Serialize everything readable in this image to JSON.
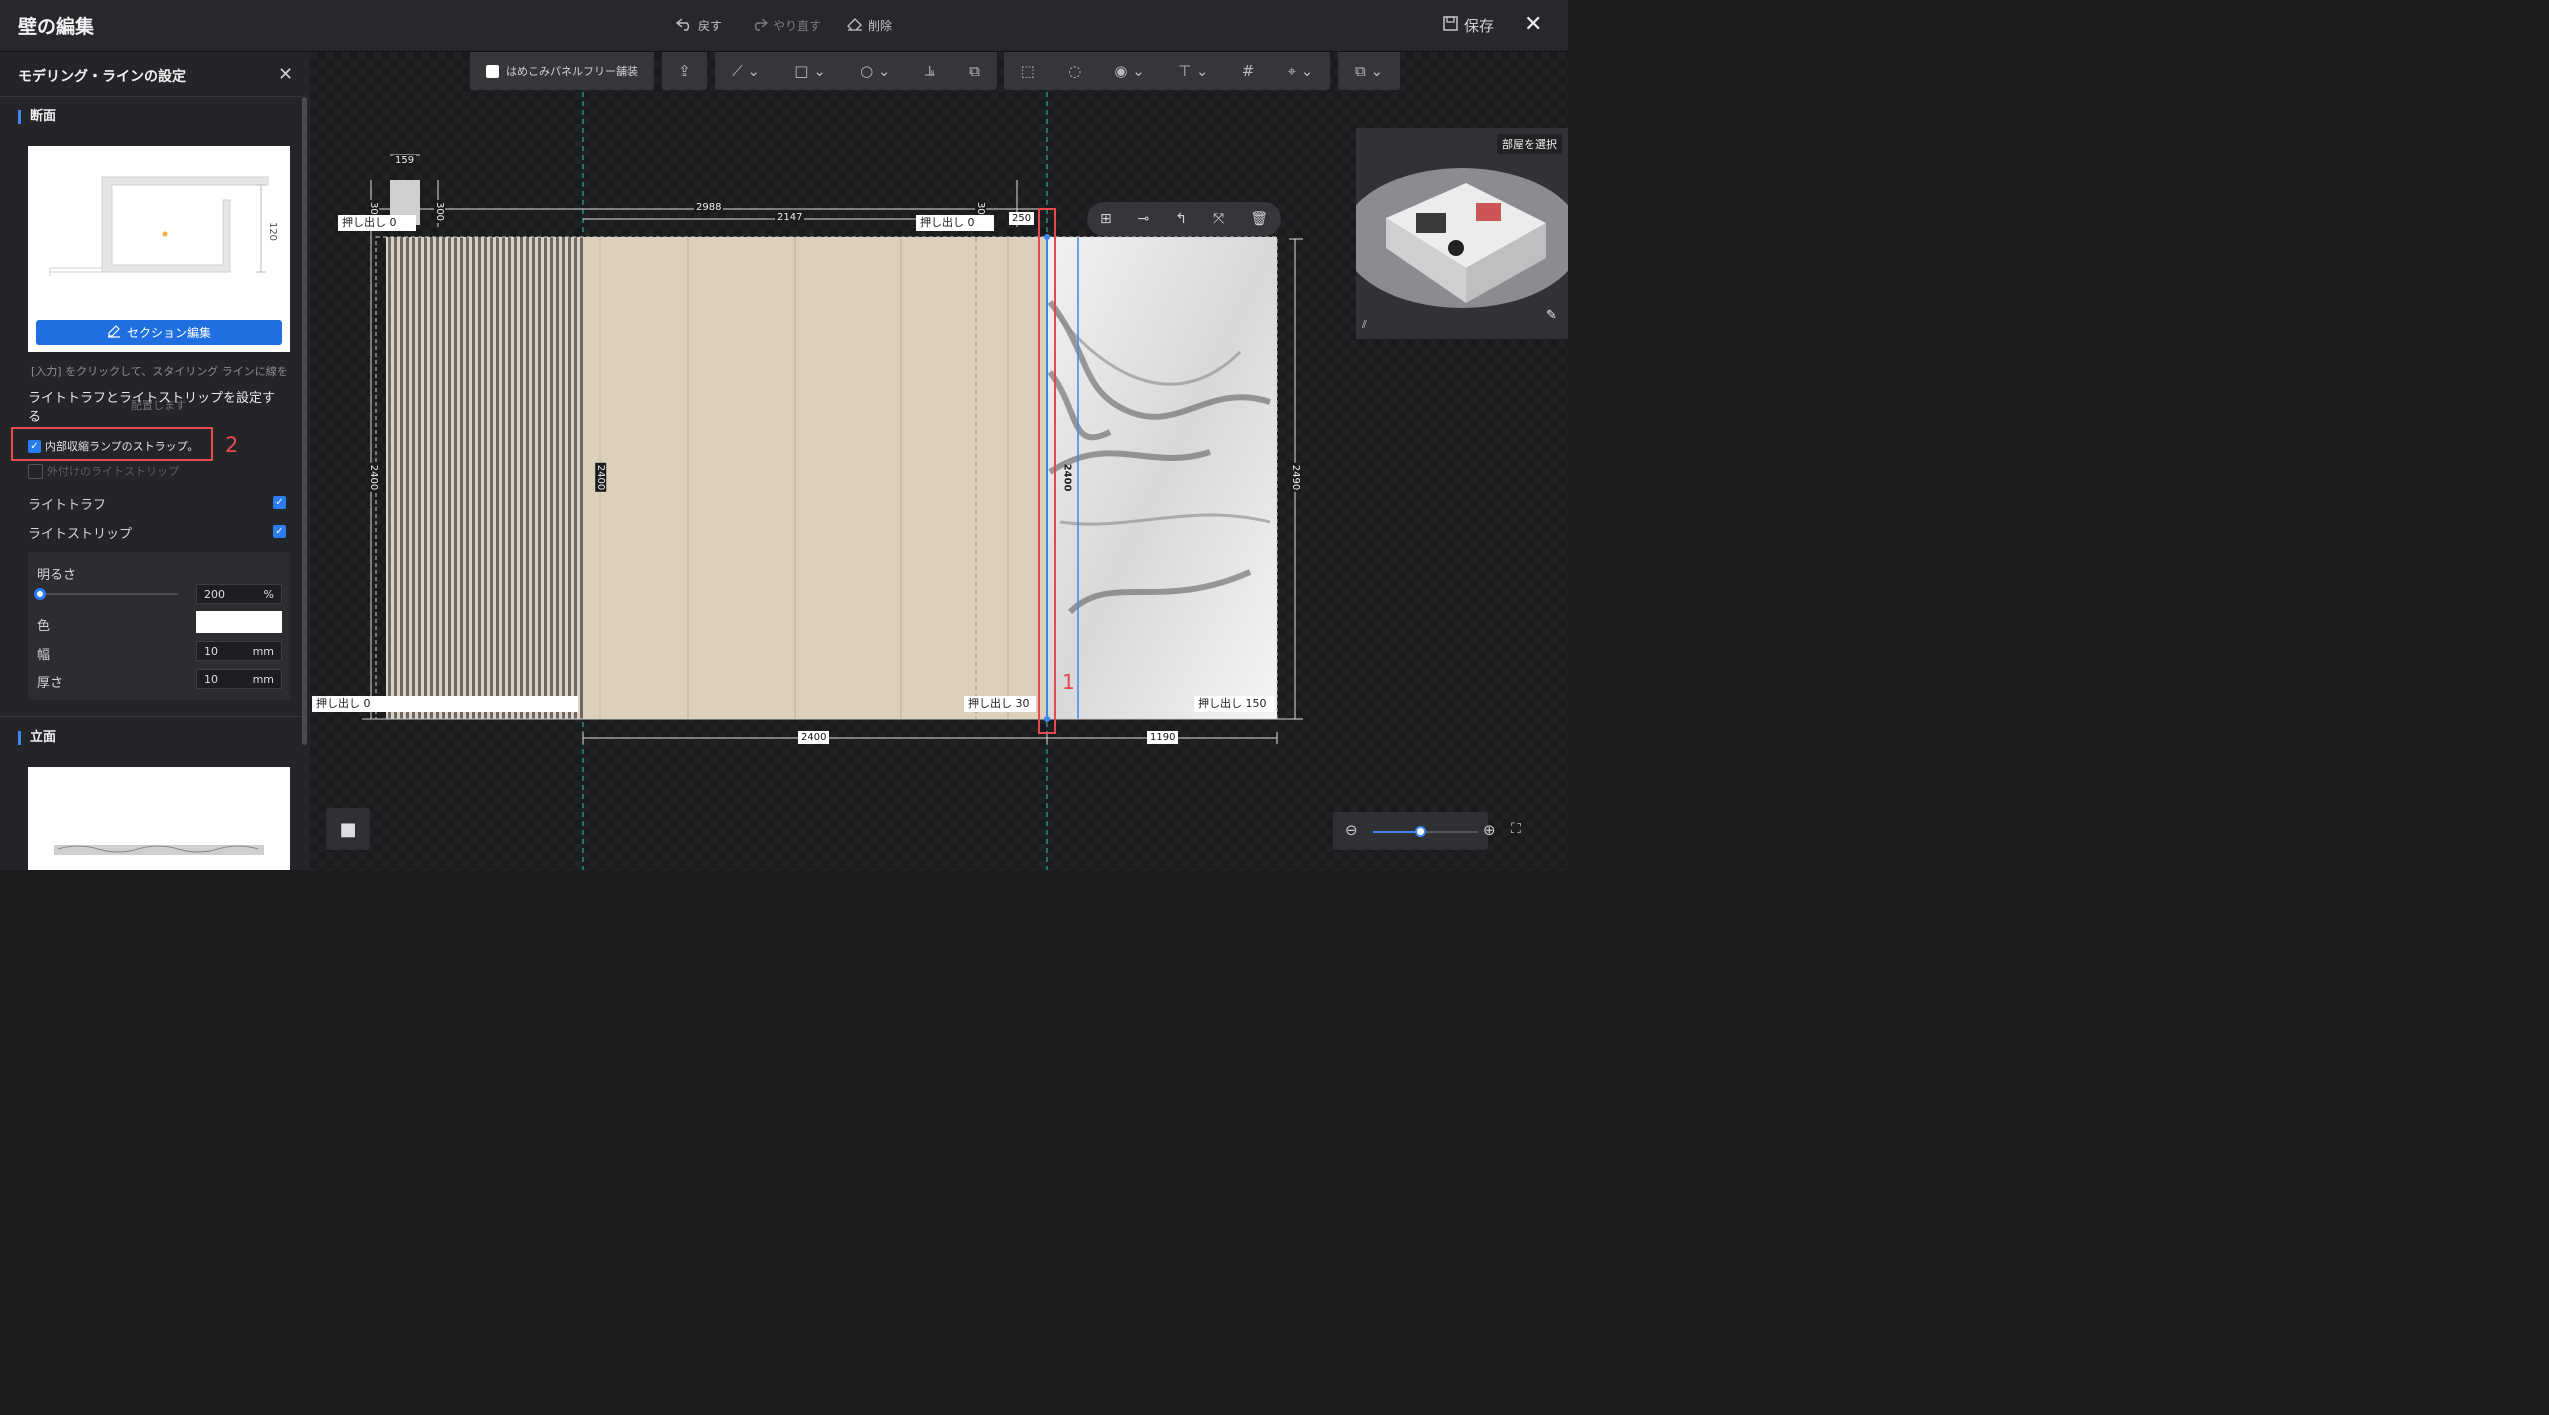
{
  "window": {
    "title": "壁の編集",
    "undo_label": "戻す",
    "redo_label": "やり直す",
    "delete_label": "削除",
    "save_label": "保存"
  },
  "sidebar": {
    "title": "モデリング・ラインの設定",
    "section_label": "断面",
    "profile_dimension": "120",
    "section_edit_label": "セクション編集",
    "input_note_line1": "[入力] をクリックして、スタイリング ラインに線を",
    "input_note_line2": "配置します",
    "light_heading_line1": "ライトトラフとライトストリップを設定す",
    "light_heading_line2": "る",
    "internal_strip_label": "内部収縮ランプのストラップ。",
    "external_strip_label": "外付けのライトストリップ",
    "light_trough_label": "ライトトラフ",
    "light_strip_label": "ライトストリップ",
    "brightness_label": "明るさ",
    "brightness_value": "200",
    "brightness_unit": "%",
    "brightness_level": 0.0,
    "color_label": "色",
    "color_value": "#ffffff",
    "width_label": "幅",
    "width_value": "10",
    "width_unit": "mm",
    "thickness_label": "厚さ",
    "thickness_value": "10",
    "thickness_unit": "mm",
    "elevation_label": "立面"
  },
  "annotations": {
    "marker_1": "1",
    "marker_2": "2",
    "highlight_color": "#e5484d"
  },
  "toolbar": {
    "flush_panel_label": "はめこみパネルフリー舗装"
  },
  "canvas": {
    "dim_159": "159",
    "dim_2988": "2988",
    "dim_2147": "2147",
    "dim_250": "250",
    "dim_300": "300",
    "dim_2400_bottom": "2400",
    "dim_1190": "1190",
    "dim_2400_vertical": "2400",
    "dim_2490": "2490",
    "strip_height_label": "2400",
    "push_label": "押し出し",
    "push_top_left": "0",
    "push_top_mid": "0",
    "push_bottom_left": "0",
    "push_bottom_mid": "30",
    "push_bottom_right": "150"
  },
  "minimap": {
    "room_select_label": "部屋を選択"
  },
  "zoom": {
    "level": 0.45
  }
}
